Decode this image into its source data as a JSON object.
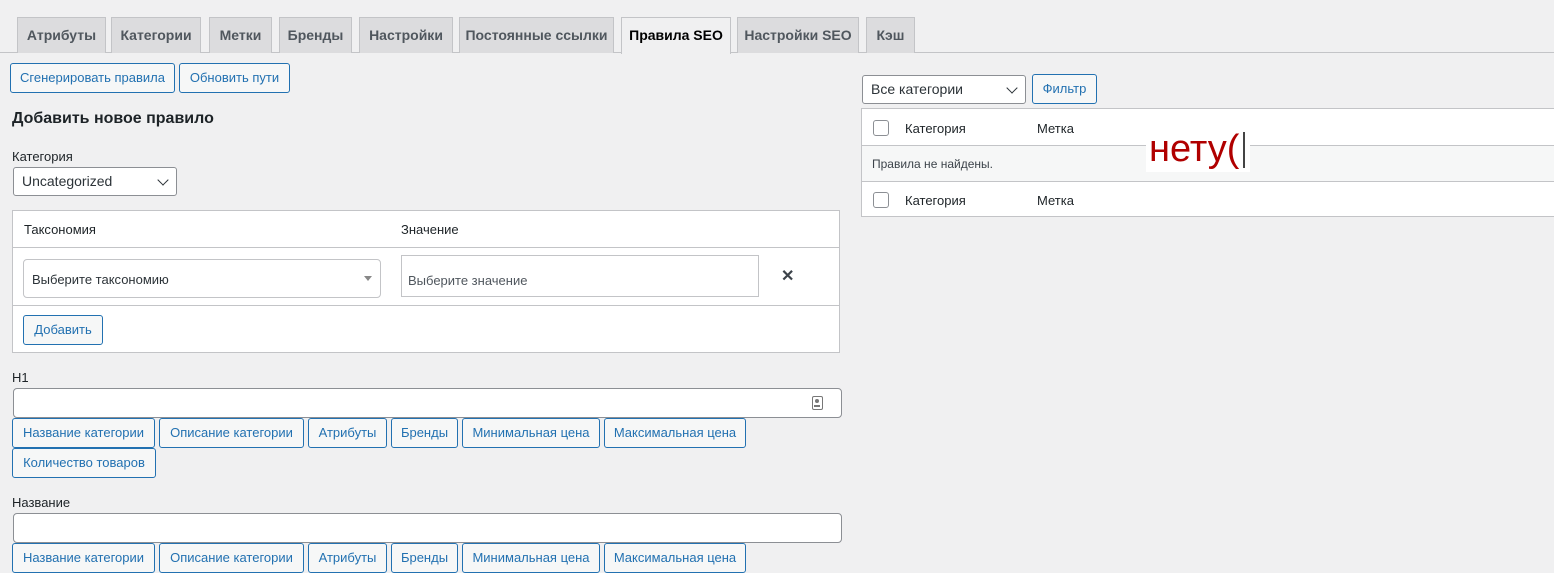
{
  "tabs": [
    "Атрибуты",
    "Категории",
    "Метки",
    "Бренды",
    "Настройки",
    "Постоянные ссылки",
    "Правила SEO",
    "Настройки SEO",
    "Кэш"
  ],
  "top_buttons": {
    "generate": "Сгенерировать правила",
    "update_paths": "Обновить пути"
  },
  "add_rule": {
    "title": "Добавить новое правило",
    "category_label": "Категория",
    "category_value": "Uncategorized",
    "taxonomy_header": "Таксономия",
    "value_header": "Значение",
    "taxonomy_placeholder": "Выберите таксономию",
    "value_placeholder": "Выберите значение",
    "remove_symbol": "✕",
    "add_button": "Добавить"
  },
  "h1_field": {
    "label": "H1",
    "chips": [
      "Название категории",
      "Описание категории",
      "Атрибуты",
      "Бренды",
      "Минимальная цена",
      "Максимальная цена",
      "Количество товаров"
    ]
  },
  "name_field": {
    "label": "Название",
    "chips": [
      "Название категории",
      "Описание категории",
      "Атрибуты",
      "Бренды",
      "Минимальная цена",
      "Максимальная цена"
    ]
  },
  "filter": {
    "select_value": "Все категории",
    "button": "Фильтр"
  },
  "rules_table": {
    "col_category": "Категория",
    "col_tag": "Метка",
    "empty_message": "Правила не найдены."
  },
  "annotation": {
    "text": "нету(",
    "color": "#b00000"
  }
}
